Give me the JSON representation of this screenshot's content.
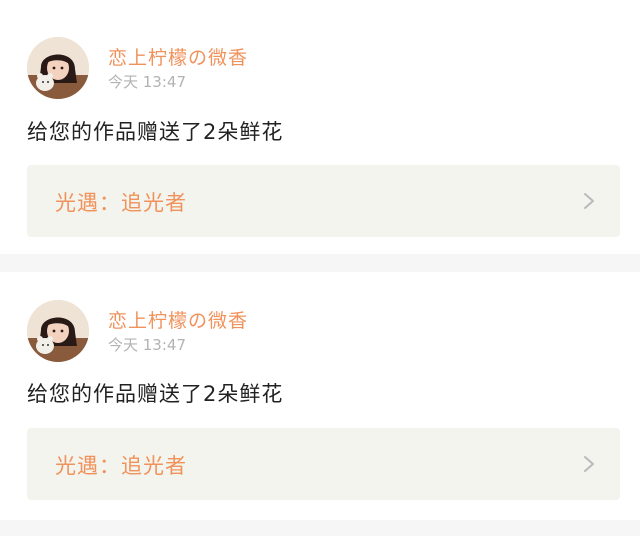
{
  "colors": {
    "accent": "#f0925c",
    "top_accent": "#f07fa6",
    "card_bg": "#ffffff",
    "page_bg": "#f6f6f6",
    "link_bg": "#f4f4ee",
    "muted_text": "#b3b3b3"
  },
  "notifications": [
    {
      "avatar_icon": "user-avatar-photo",
      "user_name": "恋上柠檬の微香",
      "time": "今天 13:47",
      "message": "给您的作品赠送了2朵鲜花",
      "work_title": "光遇：追光者",
      "chevron_icon": "chevron-right-icon"
    },
    {
      "avatar_icon": "user-avatar-photo",
      "user_name": "恋上柠檬の微香",
      "time": "今天 13:47",
      "message": "给您的作品赠送了2朵鲜花",
      "work_title": "光遇：追光者",
      "chevron_icon": "chevron-right-icon"
    }
  ]
}
